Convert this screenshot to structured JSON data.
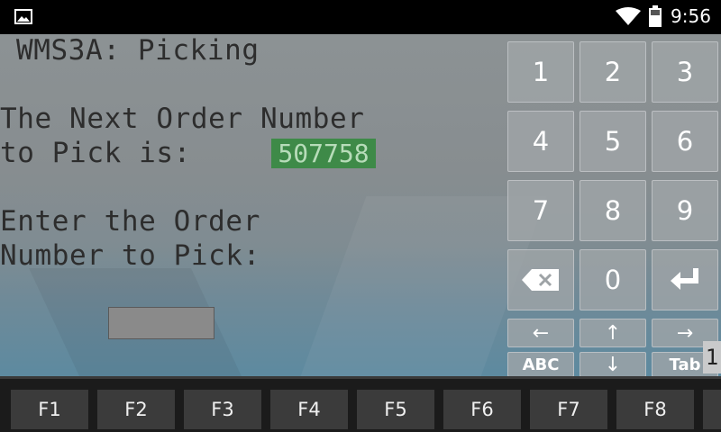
{
  "status_bar": {
    "time": "9:56",
    "icons": [
      "image-notification-icon",
      "wifi-icon",
      "battery-icon"
    ]
  },
  "screen": {
    "title": "WMS3A: Picking",
    "line1": "The Next Order Number",
    "line2": "to Pick is:",
    "order_number": "507758",
    "line3": "Enter the Order",
    "line4": "Number to Pick:",
    "input_value": ""
  },
  "keypad": {
    "digits": [
      "1",
      "2",
      "3",
      "4",
      "5",
      "6",
      "7",
      "8",
      "9",
      "0"
    ],
    "arrow_left": "←",
    "arrow_up": "↑",
    "arrow_right": "→",
    "arrow_down": "↓",
    "abc_label": "ABC",
    "tab_label": "Tab",
    "icons": [
      "backspace-icon",
      "enter-icon"
    ]
  },
  "page_indicator": "1",
  "function_keys": [
    "F1",
    "F2",
    "F3",
    "F4",
    "F5",
    "F6",
    "F7",
    "F8"
  ],
  "colors": {
    "order_highlight": "#3e8a48",
    "terminal_text": "#2d2d2d"
  }
}
